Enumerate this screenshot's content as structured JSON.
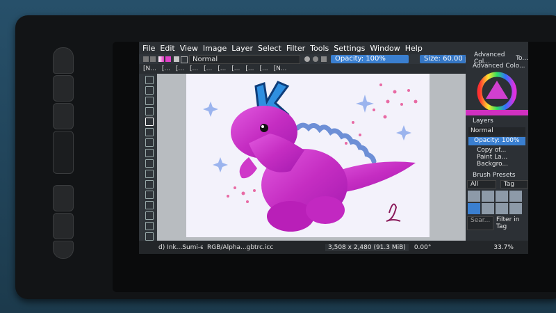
{
  "menu": [
    "File",
    "Edit",
    "View",
    "Image",
    "Layer",
    "Select",
    "Filter",
    "Tools",
    "Settings",
    "Window",
    "Help"
  ],
  "toolbar": {
    "blend_mode": "Normal",
    "opacity": "Opacity: 100%",
    "size": "Size: 60.00 px"
  },
  "tabs": [
    "[N...",
    "[...",
    "[...",
    "[...",
    "[...",
    "[...",
    "[...",
    "[...",
    "[...",
    "[N..."
  ],
  "panels": {
    "advanced_color_tab": "Advanced Col...",
    "to_tab": "To...",
    "advanced_color_title": "Advanced Colo...",
    "layers_title": "Layers",
    "layer_blend_mode": "Normal",
    "layer_opacity": "Opacity:  100%",
    "layers": [
      "Copy of...",
      "Paint La...",
      "Backgro..."
    ],
    "brush_presets_title": "Brush Presets",
    "brush_filter_all": "All",
    "brush_tag": "Tag",
    "search_placeholder": "Sear...",
    "filter_in_tag": "Filter in Tag"
  },
  "status": {
    "brush": "d) Ink...Sumi-e",
    "colorspace": "RGB/Alpha...gbtrc.icc",
    "dimensions": "3,508 x 2,480 (91.3 MiB)",
    "rotation": "0.00°",
    "zoom": "33.7%"
  },
  "colors": {
    "accent_blue": "#3a7fd0",
    "dino_pink": "#d12ab8",
    "k_blue": "#2f8fe0"
  }
}
